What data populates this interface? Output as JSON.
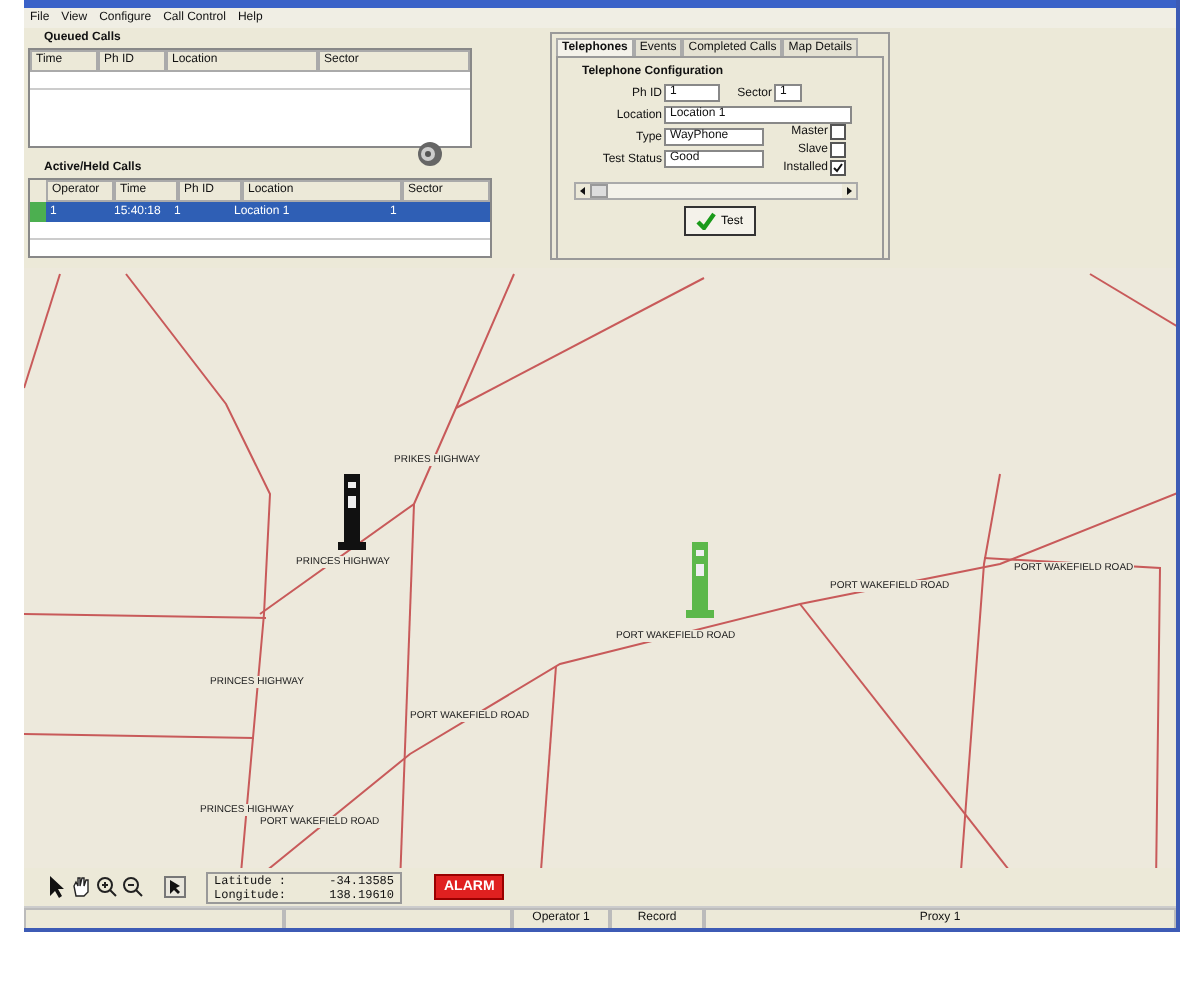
{
  "menu": [
    "File",
    "View",
    "Configure",
    "Call Control",
    "Help"
  ],
  "queued_calls": {
    "title": "Queued Calls",
    "columns": [
      "Time",
      "Ph ID",
      "Location",
      "Sector"
    ]
  },
  "active_calls": {
    "title": "Active/Held Calls",
    "columns": [
      "Operator",
      "Time",
      "Ph ID",
      "Location",
      "Sector"
    ],
    "rows": [
      {
        "selected": true,
        "color": "#4caf50",
        "cells": [
          "1",
          "15:40:18",
          "1",
          "Location 1",
          "1"
        ]
      }
    ]
  },
  "tabs": [
    {
      "label": "Telephones",
      "selected": true
    },
    {
      "label": "Events",
      "selected": false
    },
    {
      "label": "Completed Calls",
      "selected": false
    },
    {
      "label": "Map Details",
      "selected": false
    }
  ],
  "config": {
    "title": "Telephone Configuration",
    "ph_id": {
      "label": "Ph ID",
      "value": "1"
    },
    "sector": {
      "label": "Sector",
      "value": "1"
    },
    "location": {
      "label": "Location",
      "value": "Location 1"
    },
    "type": {
      "label": "Type",
      "value": "WayPhone"
    },
    "test_status": {
      "label": "Test Status",
      "value": "Good"
    },
    "checks": [
      {
        "label": "Master",
        "checked": false
      },
      {
        "label": "Slave",
        "checked": false
      },
      {
        "label": "Installed",
        "checked": true
      }
    ],
    "test_button": "Test"
  },
  "map": {
    "labels": [
      "PRIKES HIGHWAY",
      "PRINCES HIGHWAY",
      "PRINCES HIGHWAY",
      "PORT WAKEFIELD ROAD",
      "PRINCES HIGHWAY",
      "PORT WAKEFIELD ROAD",
      "PORT WAKEFIELD ROAD",
      "PORT WAKEFIELD ROAD",
      "PORT WAKEFIELD ROAD"
    ],
    "phones": [
      {
        "color": "#111111"
      },
      {
        "color": "#5cb84a"
      }
    ]
  },
  "coords": {
    "latitude_label": "Latitude :",
    "latitude": "-34.13585",
    "longitude_label": "Longitude:",
    "longitude": "138.19610"
  },
  "alarm": "ALARM",
  "status_bar": [
    "Operator 1",
    "Record",
    "Proxy 1"
  ]
}
